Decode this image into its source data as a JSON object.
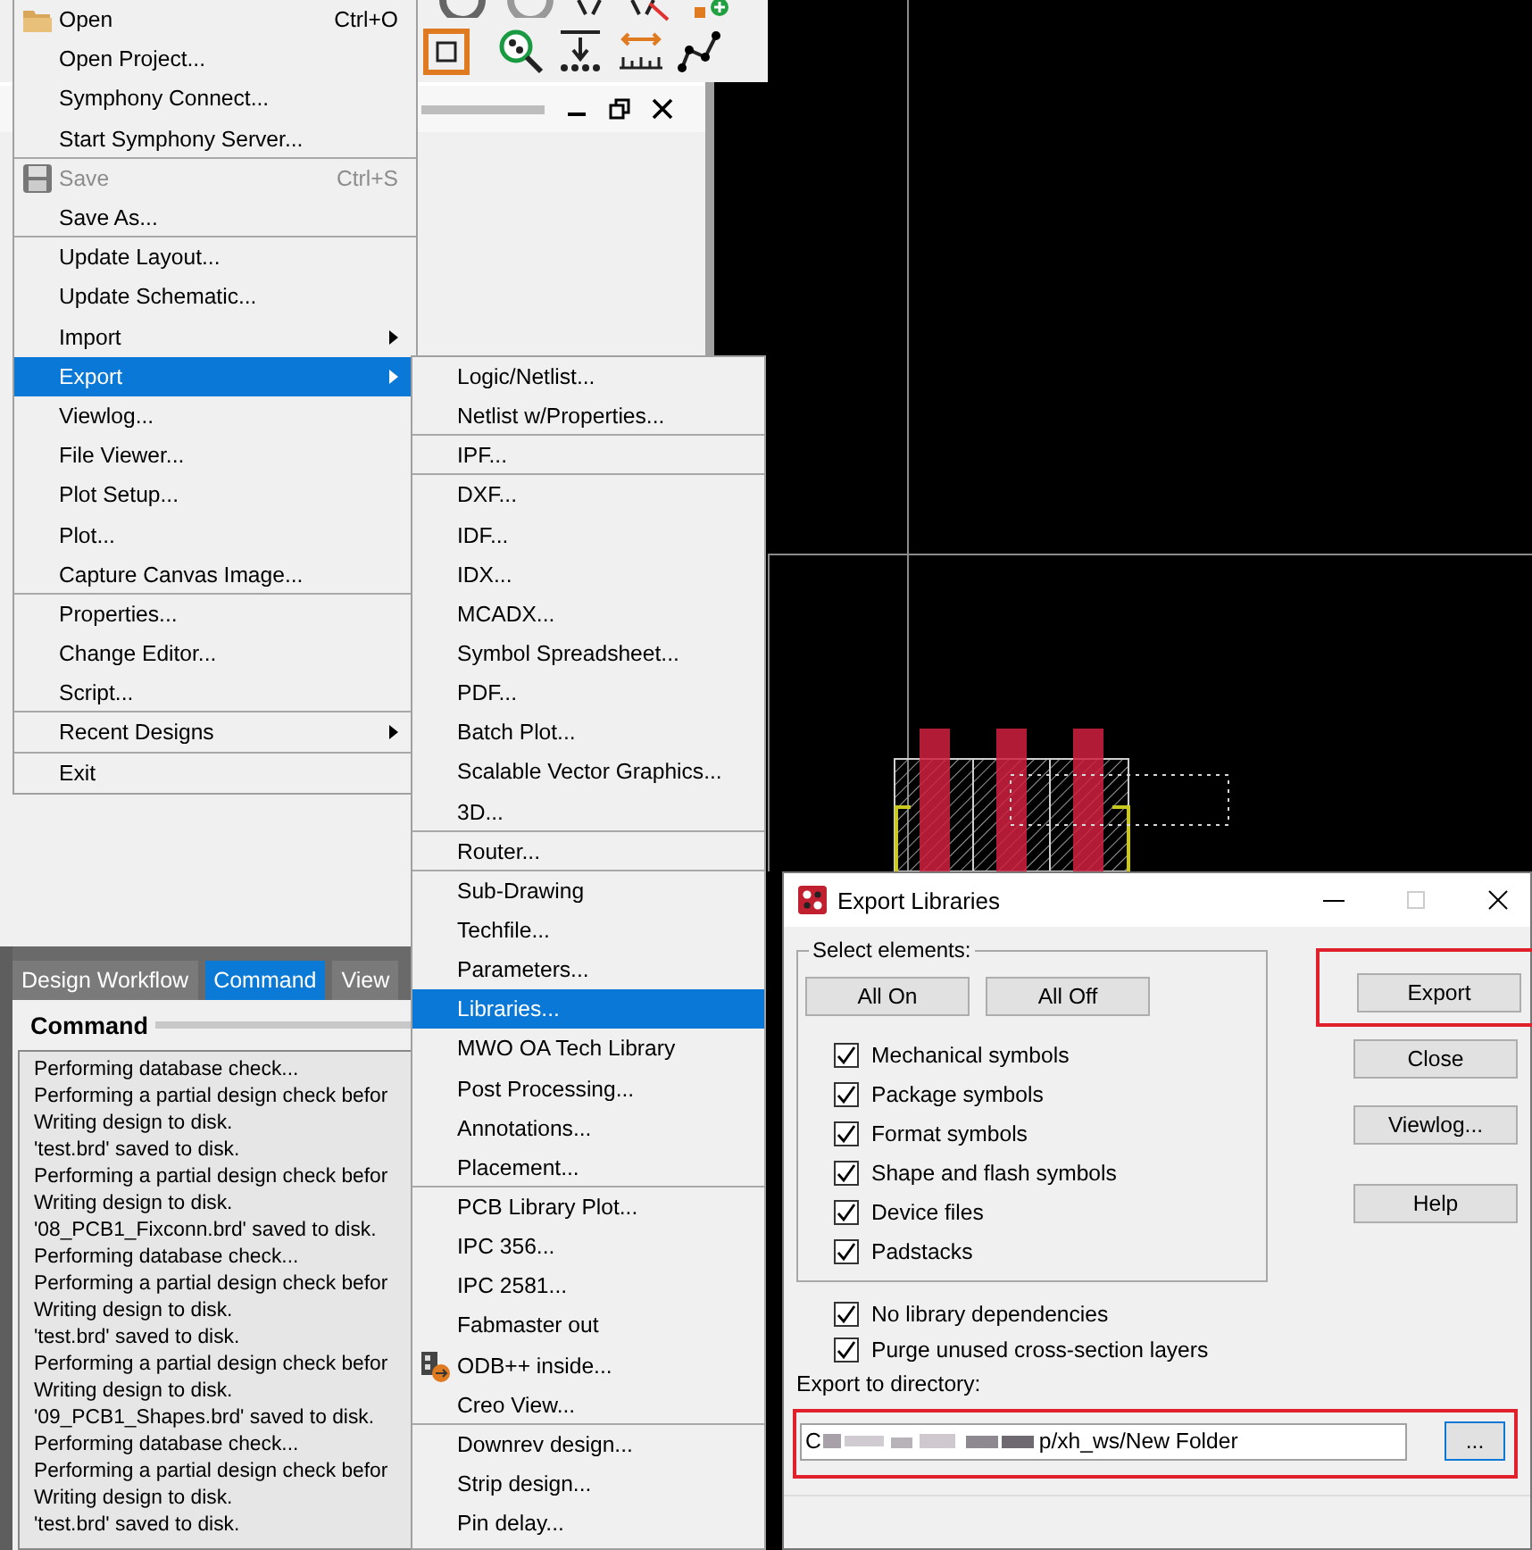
{
  "file_menu": {
    "items": [
      {
        "label": "Open",
        "shortcut": "Ctrl+O",
        "kind": "folder",
        "submenu": false,
        "disabled": false,
        "selected": false,
        "group_start": false
      },
      {
        "label": "Open Project...",
        "submenu": false,
        "disabled": false,
        "selected": false,
        "group_start": false
      },
      {
        "label": "Symphony Connect...",
        "submenu": false,
        "disabled": false,
        "selected": false,
        "group_start": false
      },
      {
        "label": "Start Symphony Server...",
        "submenu": false,
        "disabled": false,
        "selected": false,
        "group_start": false
      },
      {
        "label": "Save",
        "shortcut": "Ctrl+S",
        "kind": "floppy",
        "submenu": false,
        "disabled": true,
        "selected": false,
        "group_start": true
      },
      {
        "label": "Save As...",
        "submenu": false,
        "disabled": false,
        "selected": false,
        "group_start": false
      },
      {
        "label": "Update Layout...",
        "submenu": false,
        "disabled": false,
        "selected": false,
        "group_start": true
      },
      {
        "label": "Update Schematic...",
        "submenu": false,
        "disabled": false,
        "selected": false,
        "group_start": false
      },
      {
        "label": "Import",
        "submenu": true,
        "disabled": false,
        "selected": false,
        "group_start": false
      },
      {
        "label": "Export",
        "submenu": true,
        "disabled": false,
        "selected": true,
        "group_start": false
      },
      {
        "label": "Viewlog...",
        "submenu": false,
        "disabled": false,
        "selected": false,
        "group_start": false
      },
      {
        "label": "File Viewer...",
        "submenu": false,
        "disabled": false,
        "selected": false,
        "group_start": false
      },
      {
        "label": "Plot Setup...",
        "submenu": false,
        "disabled": false,
        "selected": false,
        "group_start": false
      },
      {
        "label": "Plot...",
        "submenu": false,
        "disabled": false,
        "selected": false,
        "group_start": false
      },
      {
        "label": "Capture Canvas Image...",
        "submenu": false,
        "disabled": false,
        "selected": false,
        "group_start": false
      },
      {
        "label": "Properties...",
        "submenu": false,
        "disabled": false,
        "selected": false,
        "group_start": true
      },
      {
        "label": "Change Editor...",
        "submenu": false,
        "disabled": false,
        "selected": false,
        "group_start": false
      },
      {
        "label": "Script...",
        "submenu": false,
        "disabled": false,
        "selected": false,
        "group_start": false
      },
      {
        "label": "Recent Designs",
        "submenu": true,
        "disabled": false,
        "selected": false,
        "group_start": true
      },
      {
        "label": "Exit",
        "submenu": false,
        "disabled": false,
        "selected": false,
        "group_start": true
      }
    ]
  },
  "export_submenu": {
    "items": [
      {
        "label": "Logic/Netlist...",
        "selected": false,
        "group_start": false
      },
      {
        "label": "Netlist w/Properties...",
        "selected": false,
        "group_start": false
      },
      {
        "label": "IPF...",
        "selected": false,
        "group_start": true
      },
      {
        "label": "DXF...",
        "selected": false,
        "group_start": true
      },
      {
        "label": "IDF...",
        "selected": false,
        "group_start": false
      },
      {
        "label": "IDX...",
        "selected": false,
        "group_start": false
      },
      {
        "label": "MCADX...",
        "selected": false,
        "group_start": false
      },
      {
        "label": "Symbol Spreadsheet...",
        "selected": false,
        "group_start": false
      },
      {
        "label": "PDF...",
        "selected": false,
        "group_start": false
      },
      {
        "label": "Batch Plot...",
        "selected": false,
        "group_start": false
      },
      {
        "label": "Scalable Vector Graphics...",
        "selected": false,
        "group_start": false
      },
      {
        "label": "3D...",
        "selected": false,
        "group_start": false
      },
      {
        "label": "Router...",
        "selected": false,
        "group_start": true
      },
      {
        "label": "Sub-Drawing",
        "selected": false,
        "group_start": true
      },
      {
        "label": "Techfile...",
        "selected": false,
        "group_start": false
      },
      {
        "label": "Parameters...",
        "selected": false,
        "group_start": false
      },
      {
        "label": "Libraries...",
        "selected": true,
        "group_start": false
      },
      {
        "label": "MWO OA Tech Library",
        "selected": false,
        "group_start": false
      },
      {
        "label": "Post Processing...",
        "selected": false,
        "group_start": false
      },
      {
        "label": "Annotations...",
        "selected": false,
        "group_start": false
      },
      {
        "label": "Placement...",
        "selected": false,
        "group_start": false
      },
      {
        "label": "PCB Library Plot...",
        "selected": false,
        "group_start": true
      },
      {
        "label": "IPC 356...",
        "selected": false,
        "group_start": false
      },
      {
        "label": "IPC 2581...",
        "selected": false,
        "group_start": false
      },
      {
        "label": "Fabmaster out",
        "selected": false,
        "group_start": false
      },
      {
        "label": "ODB++ inside...",
        "kind": "odb",
        "selected": false,
        "group_start": false
      },
      {
        "label": "Creo View...",
        "selected": false,
        "group_start": false
      },
      {
        "label": "Downrev design...",
        "selected": false,
        "group_start": true
      },
      {
        "label": "Strip design...",
        "selected": false,
        "group_start": false
      },
      {
        "label": "Pin delay...",
        "selected": false,
        "group_start": false
      }
    ]
  },
  "panel_tabs": [
    {
      "label": "Design Workflow",
      "selected": false
    },
    {
      "label": "Command",
      "selected": true
    },
    {
      "label": "View",
      "selected": false
    }
  ],
  "command_panel": {
    "title": "Command",
    "log": [
      "Performing database check...",
      "Performing a partial design check befor",
      "Writing design to disk.",
      "'test.brd' saved to disk.",
      "Performing a partial design check befor",
      "Writing design to disk.",
      "'08_PCB1_Fixconn.brd' saved to disk.",
      "Performing database check...",
      "Performing a partial design check befor",
      "Writing design to disk.",
      "'test.brd' saved to disk.",
      "Performing a partial design check befor",
      "Writing design to disk.",
      "'09_PCB1_Shapes.brd' saved to disk.",
      "Performing database check...",
      "Performing a partial design check befor",
      "Writing design to disk.",
      "'test.brd' saved to disk."
    ]
  },
  "dialog": {
    "title": "Export Libraries",
    "group_label": "Select elements:",
    "group_buttons": [
      "All On",
      "All Off"
    ],
    "group_options": [
      {
        "label": "Mechanical symbols",
        "checked": true
      },
      {
        "label": "Package symbols",
        "checked": true
      },
      {
        "label": "Format symbols",
        "checked": true
      },
      {
        "label": "Shape and flash symbols",
        "checked": true
      },
      {
        "label": "Device files",
        "checked": true
      },
      {
        "label": "Padstacks",
        "checked": true
      }
    ],
    "options": [
      {
        "label": "No library dependencies",
        "checked": true
      },
      {
        "label": "Purge unused cross-section layers",
        "checked": true
      }
    ],
    "directory_label": "Export to directory:",
    "directory": {
      "value_start": "C",
      "value_end": "p/xh_ws/New Folder",
      "highlighted": true
    },
    "browse_button": "...",
    "side_buttons": [
      {
        "label": "Export",
        "highlighted": true
      },
      {
        "label": "Close",
        "highlighted": false
      },
      {
        "label": "Viewlog...",
        "highlighted": false
      },
      {
        "label": "Help",
        "highlighted": false
      }
    ]
  }
}
